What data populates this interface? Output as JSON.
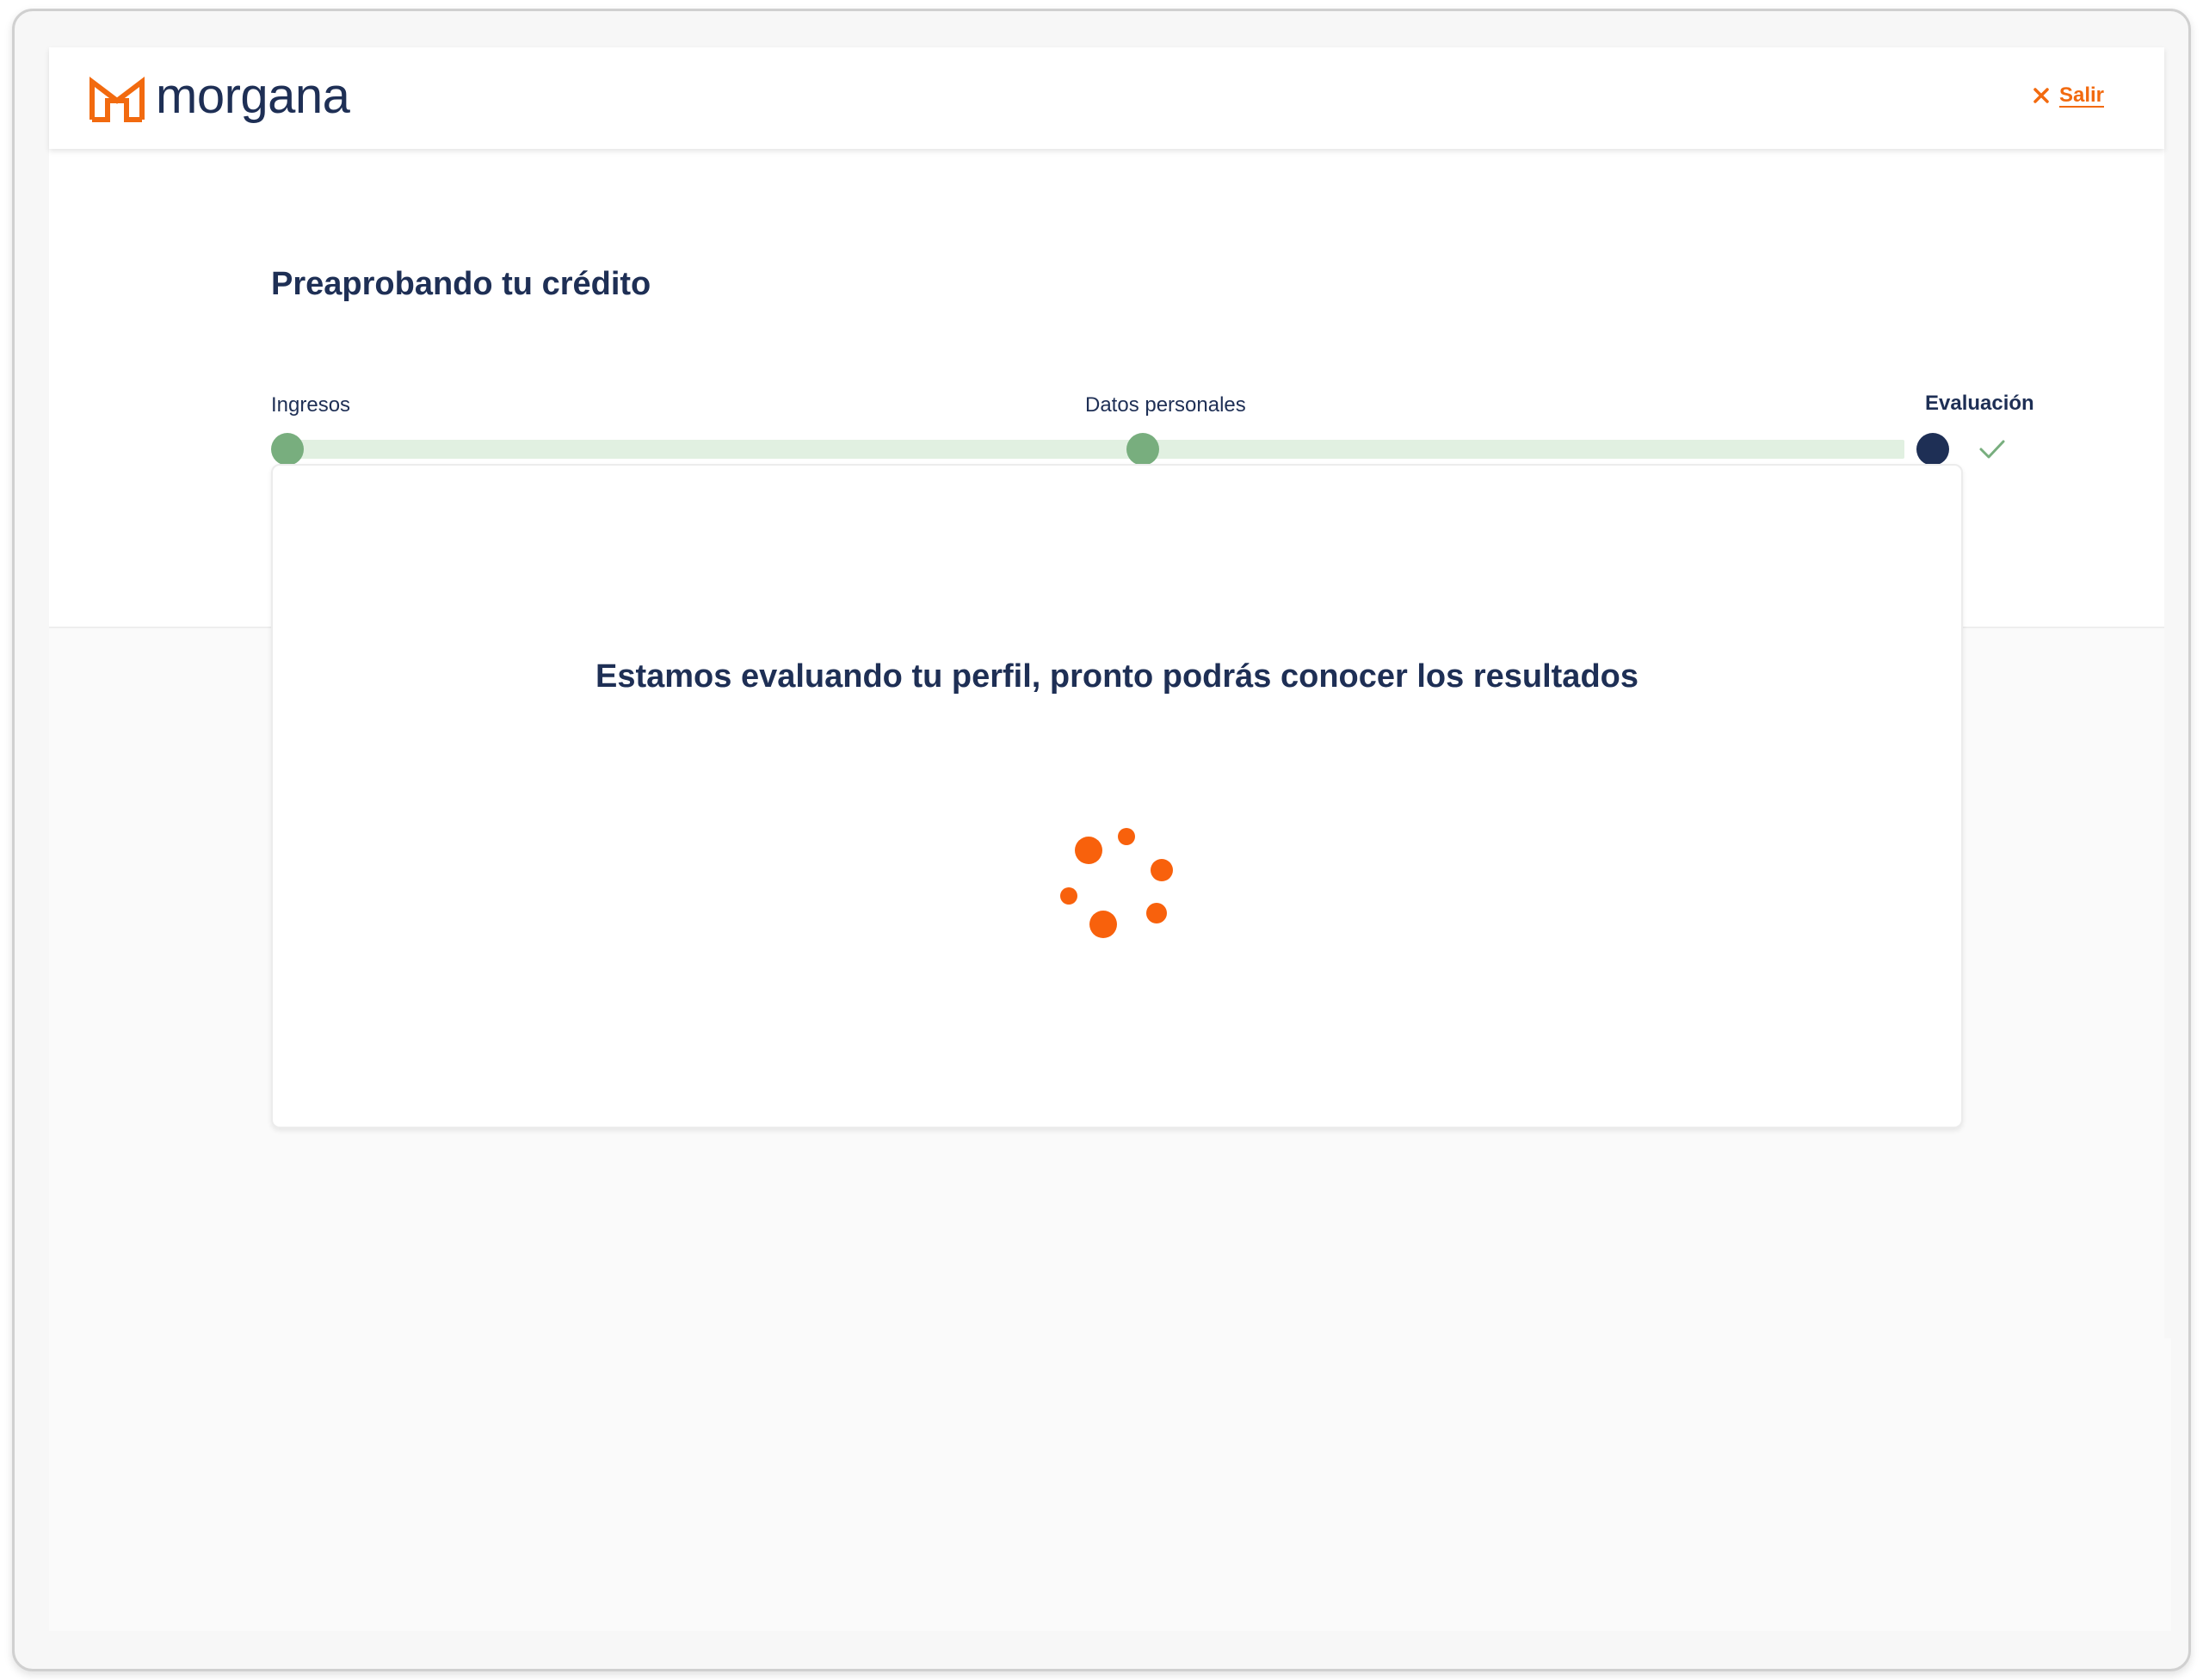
{
  "brand": {
    "name": "morgana",
    "accent_color": "#f26a0f",
    "primary_color": "#1e2f55"
  },
  "header": {
    "exit_label": "Salir",
    "exit_icon": "close-icon"
  },
  "page": {
    "title": "Preaprobando tu crédito"
  },
  "stepper": {
    "steps": [
      {
        "label": "Ingresos",
        "status": "done"
      },
      {
        "label": "Datos personales",
        "status": "done"
      },
      {
        "label": "Evaluación",
        "status": "current"
      }
    ],
    "done_color": "#78ae7e",
    "track_color": "#e1f0e1",
    "check_icon": "check-icon"
  },
  "card": {
    "message": "Estamos evaluando tu perfil, pronto podrás conocer los resultados",
    "loader_icon": "loading-spinner-icon"
  }
}
